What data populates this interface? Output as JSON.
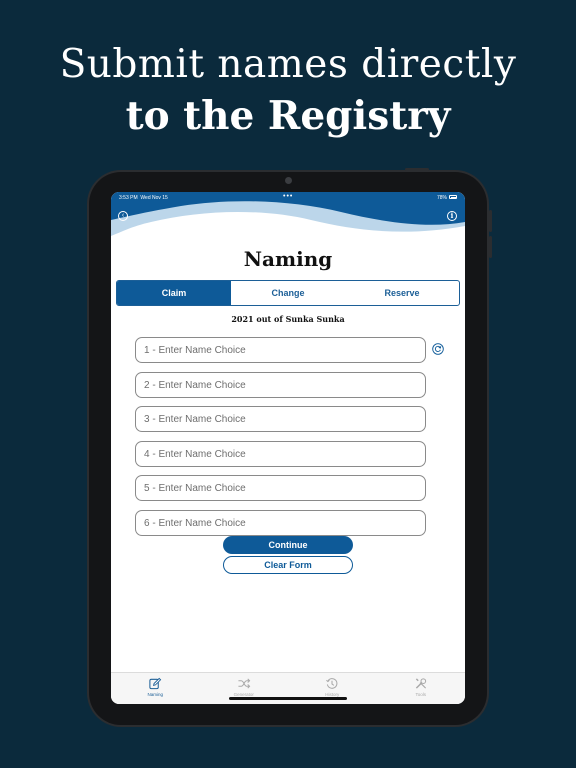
{
  "headline": {
    "line1": "Submit  names directly",
    "line2": "to the Registry"
  },
  "status_bar": {
    "time": "3:53 PM",
    "date": "Wed Nov 15",
    "dots": "•••",
    "battery": "78%"
  },
  "header": {
    "title": "Naming",
    "back_icon": "back-arrow-icon",
    "info_icon": "info-icon"
  },
  "segments": [
    {
      "label": "Claim",
      "active": true
    },
    {
      "label": "Change",
      "active": false
    },
    {
      "label": "Reserve",
      "active": false
    }
  ],
  "subtitle": "2021 out of Sunka Sunka",
  "name_fields": [
    {
      "placeholder": "1 - Enter Name Choice",
      "value": ""
    },
    {
      "placeholder": "2 - Enter Name Choice",
      "value": ""
    },
    {
      "placeholder": "3 - Enter Name Choice",
      "value": ""
    },
    {
      "placeholder": "4 - Enter Name Choice",
      "value": ""
    },
    {
      "placeholder": "5 - Enter Name Choice",
      "value": ""
    },
    {
      "placeholder": "6 - Enter Name Choice",
      "value": ""
    }
  ],
  "refresh_icon": "refresh-icon",
  "actions": {
    "continue_label": "Continue",
    "clear_label": "Clear Form"
  },
  "tabbar": [
    {
      "label": "Naming",
      "icon": "edit-icon",
      "active": true
    },
    {
      "label": "Generator",
      "icon": "shuffle-icon",
      "active": false
    },
    {
      "label": "History",
      "icon": "history-icon",
      "active": false
    },
    {
      "label": "Tools",
      "icon": "tools-icon",
      "active": false
    }
  ],
  "colors": {
    "background": "#0b2a3c",
    "primary": "#0e5a98",
    "wave_light": "#bcd6ea"
  }
}
